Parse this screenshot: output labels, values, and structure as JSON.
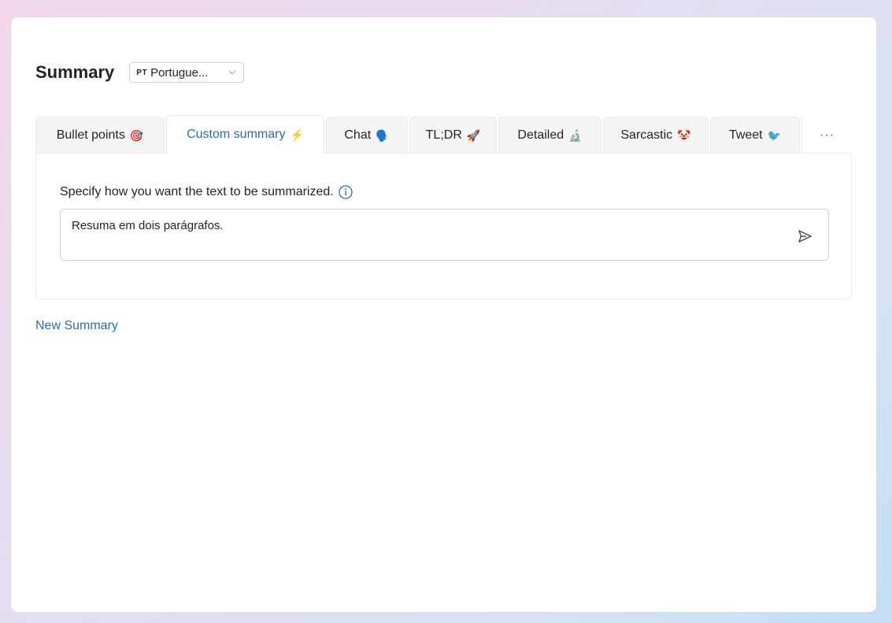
{
  "header": {
    "title": "Summary",
    "language_code": "PT",
    "language_label": "Portugue..."
  },
  "tabs": [
    {
      "label": "Bullet points",
      "emoji": "🎯",
      "active": false,
      "width": 164
    },
    {
      "label": "Custom summary",
      "emoji": "⚡",
      "active": true,
      "width": 201
    },
    {
      "label": "Chat",
      "emoji": "🗣️",
      "active": false,
      "width": 104
    },
    {
      "label": "TL;DR",
      "emoji": "🚀",
      "active": false,
      "width": 111
    },
    {
      "label": "Detailed",
      "emoji": "🔬",
      "active": false,
      "width": 131
    },
    {
      "label": "Sarcastic",
      "emoji": "🤡",
      "active": false,
      "width": 134
    },
    {
      "label": "Tweet",
      "emoji": "🐦",
      "active": false,
      "width": 114
    }
  ],
  "more_label": "···",
  "panel": {
    "instruction": "Specify how you want the text to be summarized.",
    "prompt_value": "Resuma em dois parágrafos."
  },
  "new_summary_label": "New Summary",
  "colors": {
    "accent": "#2b6cb0",
    "text": "#242424"
  }
}
